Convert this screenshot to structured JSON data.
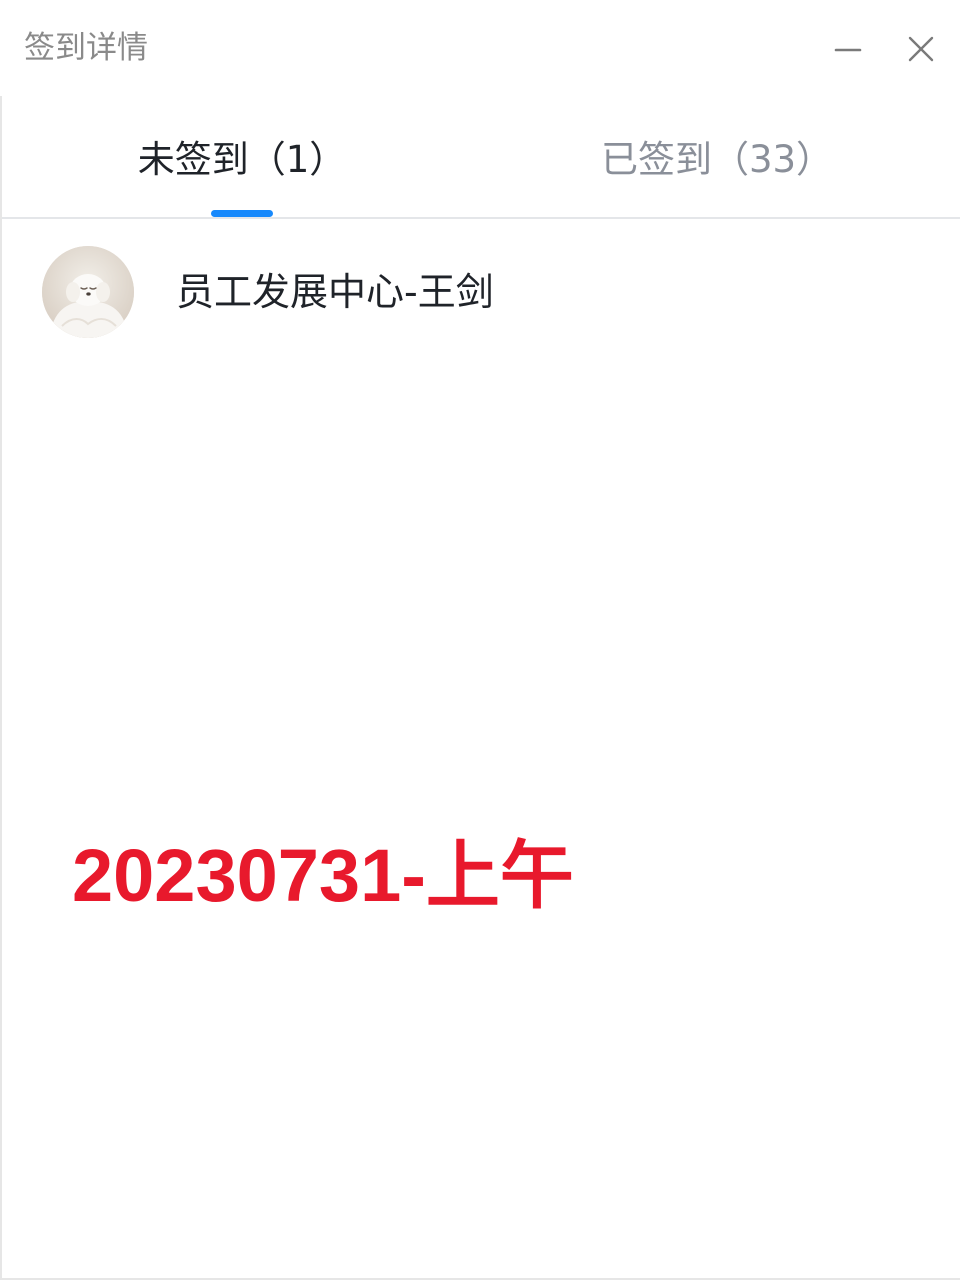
{
  "window": {
    "title": "签到详情",
    "minimize_icon": "minimize-icon",
    "close_icon": "close-icon"
  },
  "tabs": [
    {
      "label": "未签到（1）",
      "active": true
    },
    {
      "label": "已签到（33）",
      "active": false
    }
  ],
  "members": [
    {
      "name": "员工发展中心-王剑",
      "avatar_icon": "avatar-white-puppy"
    }
  ],
  "overlay": {
    "text": "20230731-上午"
  },
  "colors": {
    "accent": "#1789fc",
    "primary_text": "#1f2329",
    "secondary_text": "#8a8f99",
    "overlay_red": "#e8192c"
  }
}
